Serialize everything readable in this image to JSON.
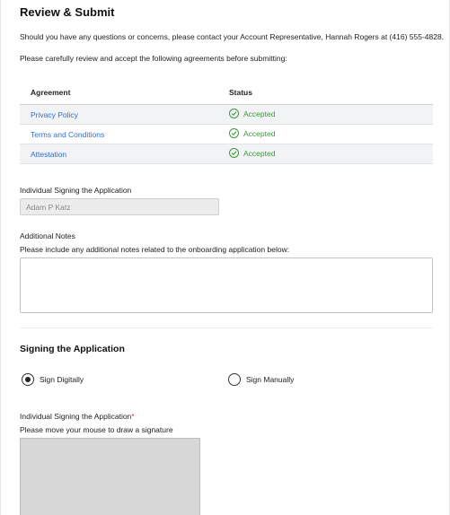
{
  "page": {
    "title": "Review & Submit",
    "contact_text": "Should you have any questions or concerns, please contact your Account Representative, Hannah Rogers at (416) 555-4828.",
    "review_instruction": "Please carefully review and accept the following agreements before submitting:"
  },
  "agreements": {
    "headers": {
      "agreement": "Agreement",
      "status": "Status"
    },
    "rows": [
      {
        "name": "Privacy Policy",
        "status": "Accepted"
      },
      {
        "name": "Terms and Conditions",
        "status": "Accepted"
      },
      {
        "name": "Attestation",
        "status": "Accepted"
      }
    ]
  },
  "signer": {
    "label": "Individual Signing the Application",
    "value": "Adam P Katz"
  },
  "notes": {
    "label": "Additional Notes",
    "help": "Please include any additional notes related to the onboarding application below:",
    "value": ""
  },
  "signing": {
    "title": "Signing the Application",
    "options": [
      {
        "label": "Sign Digitally",
        "selected": true
      },
      {
        "label": "Sign Manually",
        "selected": false
      }
    ],
    "signature_label": "Individual Signing the Application",
    "required_mark": "*",
    "signature_help": "Please move your mouse to draw a signature"
  },
  "colors": {
    "link": "#2f6fcf",
    "accepted": "#3a9a3a",
    "required": "#d33333"
  }
}
